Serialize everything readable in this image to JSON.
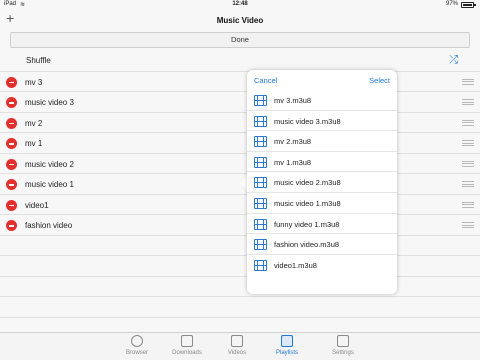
{
  "status_bar": {
    "device": "iPad",
    "time": "12:48",
    "battery": "97%"
  },
  "nav": {
    "title": "Music Video",
    "add_symbol": "+"
  },
  "done_label": "Done",
  "shuffle": {
    "label": "Shuffle",
    "icon": "shuffle-icon"
  },
  "playlist_items": [
    {
      "label": "mv 3"
    },
    {
      "label": "music video 3"
    },
    {
      "label": "mv 2"
    },
    {
      "label": "mv 1"
    },
    {
      "label": "music video 2"
    },
    {
      "label": "music video 1"
    },
    {
      "label": "video1"
    },
    {
      "label": "fashion video"
    }
  ],
  "popover": {
    "cancel_label": "Cancel",
    "select_label": "Select",
    "files": [
      {
        "label": "mv 3.m3u8"
      },
      {
        "label": "music video 3.m3u8"
      },
      {
        "label": "mv 2.m3u8"
      },
      {
        "label": "mv 1.m3u8"
      },
      {
        "label": "music video 2.m3u8"
      },
      {
        "label": "music video 1.m3u8"
      },
      {
        "label": "funny video 1.m3u8"
      },
      {
        "label": "fashion video.m3u8"
      },
      {
        "label": "video1.m3u8"
      }
    ]
  },
  "tabs": [
    {
      "label": "Browser",
      "icon": "globe-icon",
      "active": false
    },
    {
      "label": "Downloads",
      "icon": "download-icon",
      "active": false
    },
    {
      "label": "Videos",
      "icon": "video-icon",
      "active": false
    },
    {
      "label": "Playlists",
      "icon": "playlist-icon",
      "active": true
    },
    {
      "label": "Settings",
      "icon": "settings-icon",
      "active": false
    }
  ],
  "colors": {
    "accent": "#1d77d6",
    "delete": "#e3302c"
  }
}
